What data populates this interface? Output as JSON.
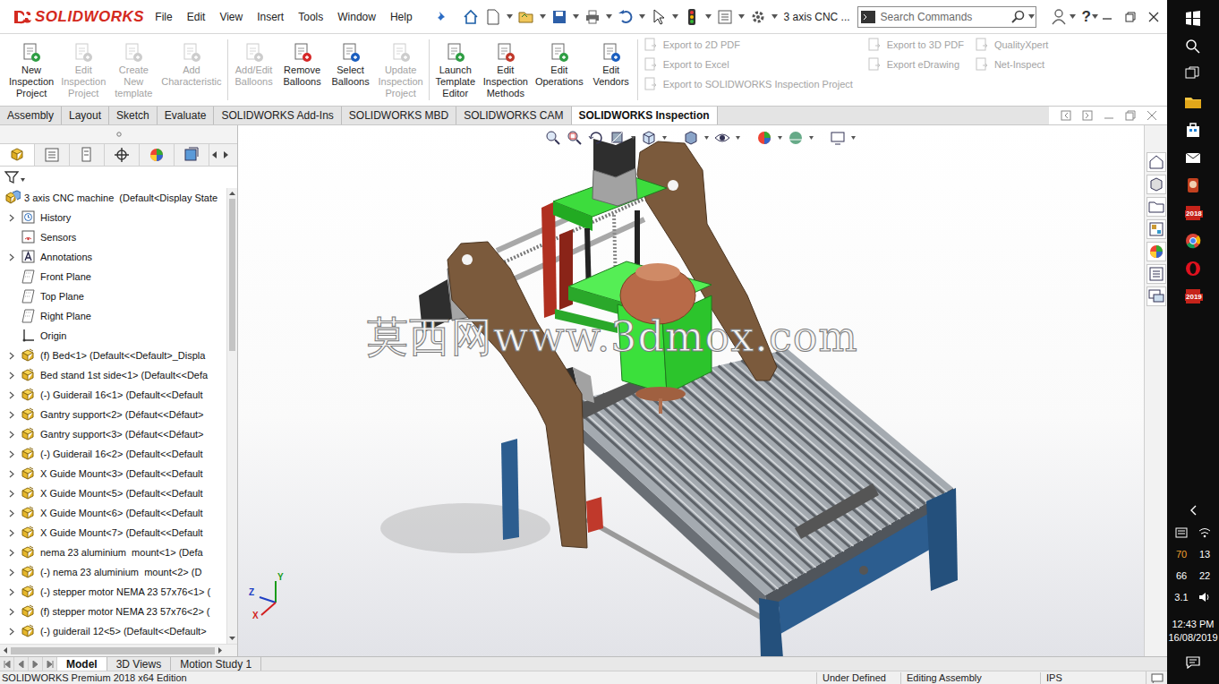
{
  "app": {
    "logo": "SOLIDWORKS",
    "document_title": "3 axis CNC ...",
    "help": "?"
  },
  "menu": [
    "File",
    "Edit",
    "View",
    "Insert",
    "Tools",
    "Window",
    "Help"
  ],
  "search": {
    "placeholder": "Search Commands"
  },
  "ribbon": {
    "groups": [
      [
        {
          "label": [
            "New",
            "Inspection",
            "Project"
          ],
          "disabled": false
        },
        {
          "label": [
            "Edit",
            "Inspection",
            "Project"
          ],
          "disabled": true
        },
        {
          "label": [
            "Create",
            "New",
            "template"
          ],
          "disabled": true
        },
        {
          "label": [
            "Add",
            "Characteristic"
          ],
          "disabled": true
        }
      ],
      [
        {
          "label": [
            "Add/Edit",
            "Balloons"
          ],
          "disabled": true
        },
        {
          "label": [
            "Remove",
            "Balloons"
          ],
          "disabled": false
        },
        {
          "label": [
            "Select",
            "Balloons"
          ],
          "disabled": false
        },
        {
          "label": [
            "Update",
            "Inspection",
            "Project"
          ],
          "disabled": true
        }
      ],
      [
        {
          "label": [
            "Launch",
            "Template",
            "Editor"
          ],
          "disabled": false
        },
        {
          "label": [
            "Edit",
            "Inspection",
            "Methods"
          ],
          "disabled": false
        },
        {
          "label": [
            "Edit",
            "Operations"
          ],
          "disabled": false
        },
        {
          "label": [
            "Edit",
            "Vendors"
          ],
          "disabled": false
        }
      ]
    ],
    "small_columns": [
      [
        {
          "label": "Export to 2D PDF",
          "disabled": true
        },
        {
          "label": "Export to Excel",
          "disabled": true
        },
        {
          "label": "Export to SOLIDWORKS Inspection Project",
          "disabled": true
        }
      ],
      [
        {
          "label": "Export to 3D PDF",
          "disabled": true
        },
        {
          "label": "Export eDrawing",
          "disabled": true
        }
      ],
      [
        {
          "label": "QualityXpert",
          "disabled": true
        },
        {
          "label": "Net-Inspect",
          "disabled": true
        }
      ]
    ]
  },
  "tabs": [
    {
      "label": "Assembly",
      "selected": false
    },
    {
      "label": "Layout",
      "selected": false
    },
    {
      "label": "Sketch",
      "selected": false
    },
    {
      "label": "Evaluate",
      "selected": false
    },
    {
      "label": "SOLIDWORKS Add-Ins",
      "selected": false
    },
    {
      "label": "SOLIDWORKS MBD",
      "selected": false
    },
    {
      "label": "SOLIDWORKS CAM",
      "selected": false
    },
    {
      "label": "SOLIDWORKS Inspection",
      "selected": true
    }
  ],
  "feature_tree": {
    "items": [
      {
        "label": "3 axis CNC machine  (Default<Display State",
        "kind": "root",
        "expandable": false
      },
      {
        "label": "History",
        "kind": "history",
        "expandable": true
      },
      {
        "label": "Sensors",
        "kind": "sensors",
        "expandable": false
      },
      {
        "label": "Annotations",
        "kind": "annotations",
        "expandable": true
      },
      {
        "label": "Front Plane",
        "kind": "plane",
        "expandable": false
      },
      {
        "label": "Top Plane",
        "kind": "plane",
        "expandable": false
      },
      {
        "label": "Right Plane",
        "kind": "plane",
        "expandable": false
      },
      {
        "label": "Origin",
        "kind": "origin",
        "expandable": false
      },
      {
        "label": "(f) Bed<1> (Default<<Default>_Displa",
        "kind": "part",
        "expandable": true
      },
      {
        "label": "Bed stand 1st side<1> (Default<<Defa",
        "kind": "part",
        "expandable": true
      },
      {
        "label": "(-) Guiderail 16<1> (Default<<Default",
        "kind": "part",
        "expandable": true
      },
      {
        "label": "Gantry support<2> (Défaut<<Défaut>",
        "kind": "part",
        "expandable": true
      },
      {
        "label": "Gantry support<3> (Défaut<<Défaut>",
        "kind": "part",
        "expandable": true
      },
      {
        "label": "(-) Guiderail 16<2> (Default<<Default",
        "kind": "part",
        "expandable": true
      },
      {
        "label": "X Guide Mount<3> (Default<<Default",
        "kind": "part",
        "expandable": true
      },
      {
        "label": "X Guide Mount<5> (Default<<Default",
        "kind": "part",
        "expandable": true
      },
      {
        "label": "X Guide Mount<6> (Default<<Default",
        "kind": "part",
        "expandable": true
      },
      {
        "label": "X Guide Mount<7> (Default<<Default",
        "kind": "part",
        "expandable": true
      },
      {
        "label": "nema 23 aluminium  mount<1> (Defa",
        "kind": "part",
        "expandable": true
      },
      {
        "label": "(-) nema 23 aluminium  mount<2> (D",
        "kind": "part",
        "expandable": true
      },
      {
        "label": "(-) stepper motor NEMA 23 57x76<1> (",
        "kind": "part",
        "expandable": true
      },
      {
        "label": "(f) stepper motor NEMA 23 57x76<2> (",
        "kind": "part",
        "expandable": true
      },
      {
        "label": "(-) guiderail 12<5> (Default<<Default>",
        "kind": "part",
        "expandable": true
      }
    ]
  },
  "viewport": {
    "watermark": "莫西网www.3dmox.com",
    "axes": [
      {
        "label": "Y",
        "color": "#1a9c1a"
      },
      {
        "label": "Z",
        "color": "#1f3fc4"
      },
      {
        "label": "X",
        "color": "#d21f1f"
      }
    ]
  },
  "bottom_tabs": [
    {
      "label": "Model",
      "selected": true
    },
    {
      "label": "3D Views",
      "selected": false
    },
    {
      "label": "Motion Study 1",
      "selected": false
    }
  ],
  "status_bar": {
    "edition": "SOLIDWORKS Premium 2018 x64 Edition",
    "items": [
      "Under Defined",
      "Editing Assembly",
      "IPS"
    ]
  },
  "taskbar": {
    "badges": [
      "2018",
      "2019"
    ],
    "tray": [
      {
        "text": "70",
        "color": "#f0a030"
      },
      {
        "text": "13",
        "color": "#ffffff"
      },
      {
        "text": "66",
        "color": "#ffffff"
      },
      {
        "text": "22",
        "color": "#ffffff"
      },
      {
        "text": "3.1",
        "color": "#ffffff"
      }
    ],
    "time": "12:43 PM",
    "date": "16/08/2019"
  }
}
